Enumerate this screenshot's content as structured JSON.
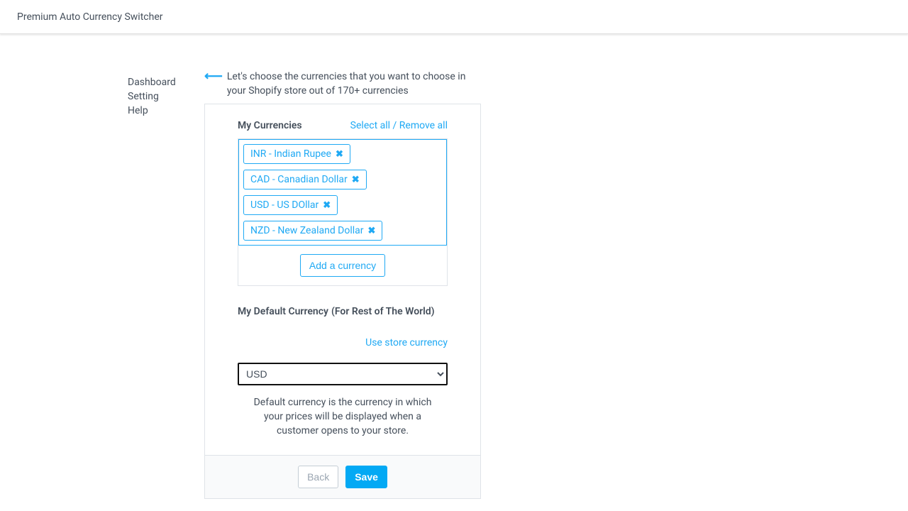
{
  "topbar": {
    "title": "Premium Auto Currency Switcher"
  },
  "sidebar": {
    "items": [
      {
        "label": "Dashboard"
      },
      {
        "label": "Setting"
      },
      {
        "label": "Help"
      }
    ]
  },
  "intro": {
    "text": "Let's choose the currencies that you want to choose in your Shopify store out of 170+ currencies"
  },
  "myCurrencies": {
    "title": "My Currencies",
    "selectAll": "Select all / Remove all",
    "tags": [
      {
        "label": "INR - Indian Rupee"
      },
      {
        "label": "CAD - Canadian Dollar"
      },
      {
        "label": "USD - US DOllar"
      },
      {
        "label": "NZD - New Zealand Dollar"
      }
    ],
    "addLabel": "Add a currency"
  },
  "defaultCurrency": {
    "title": "My Default Currency",
    "subtitle": "(For Rest of The World)",
    "useStore": "Use store currency",
    "selected": "USD",
    "help": "Default currency is the currency in which your prices will be displayed when a customer opens to your store."
  },
  "footer": {
    "back": "Back",
    "save": "Save"
  }
}
